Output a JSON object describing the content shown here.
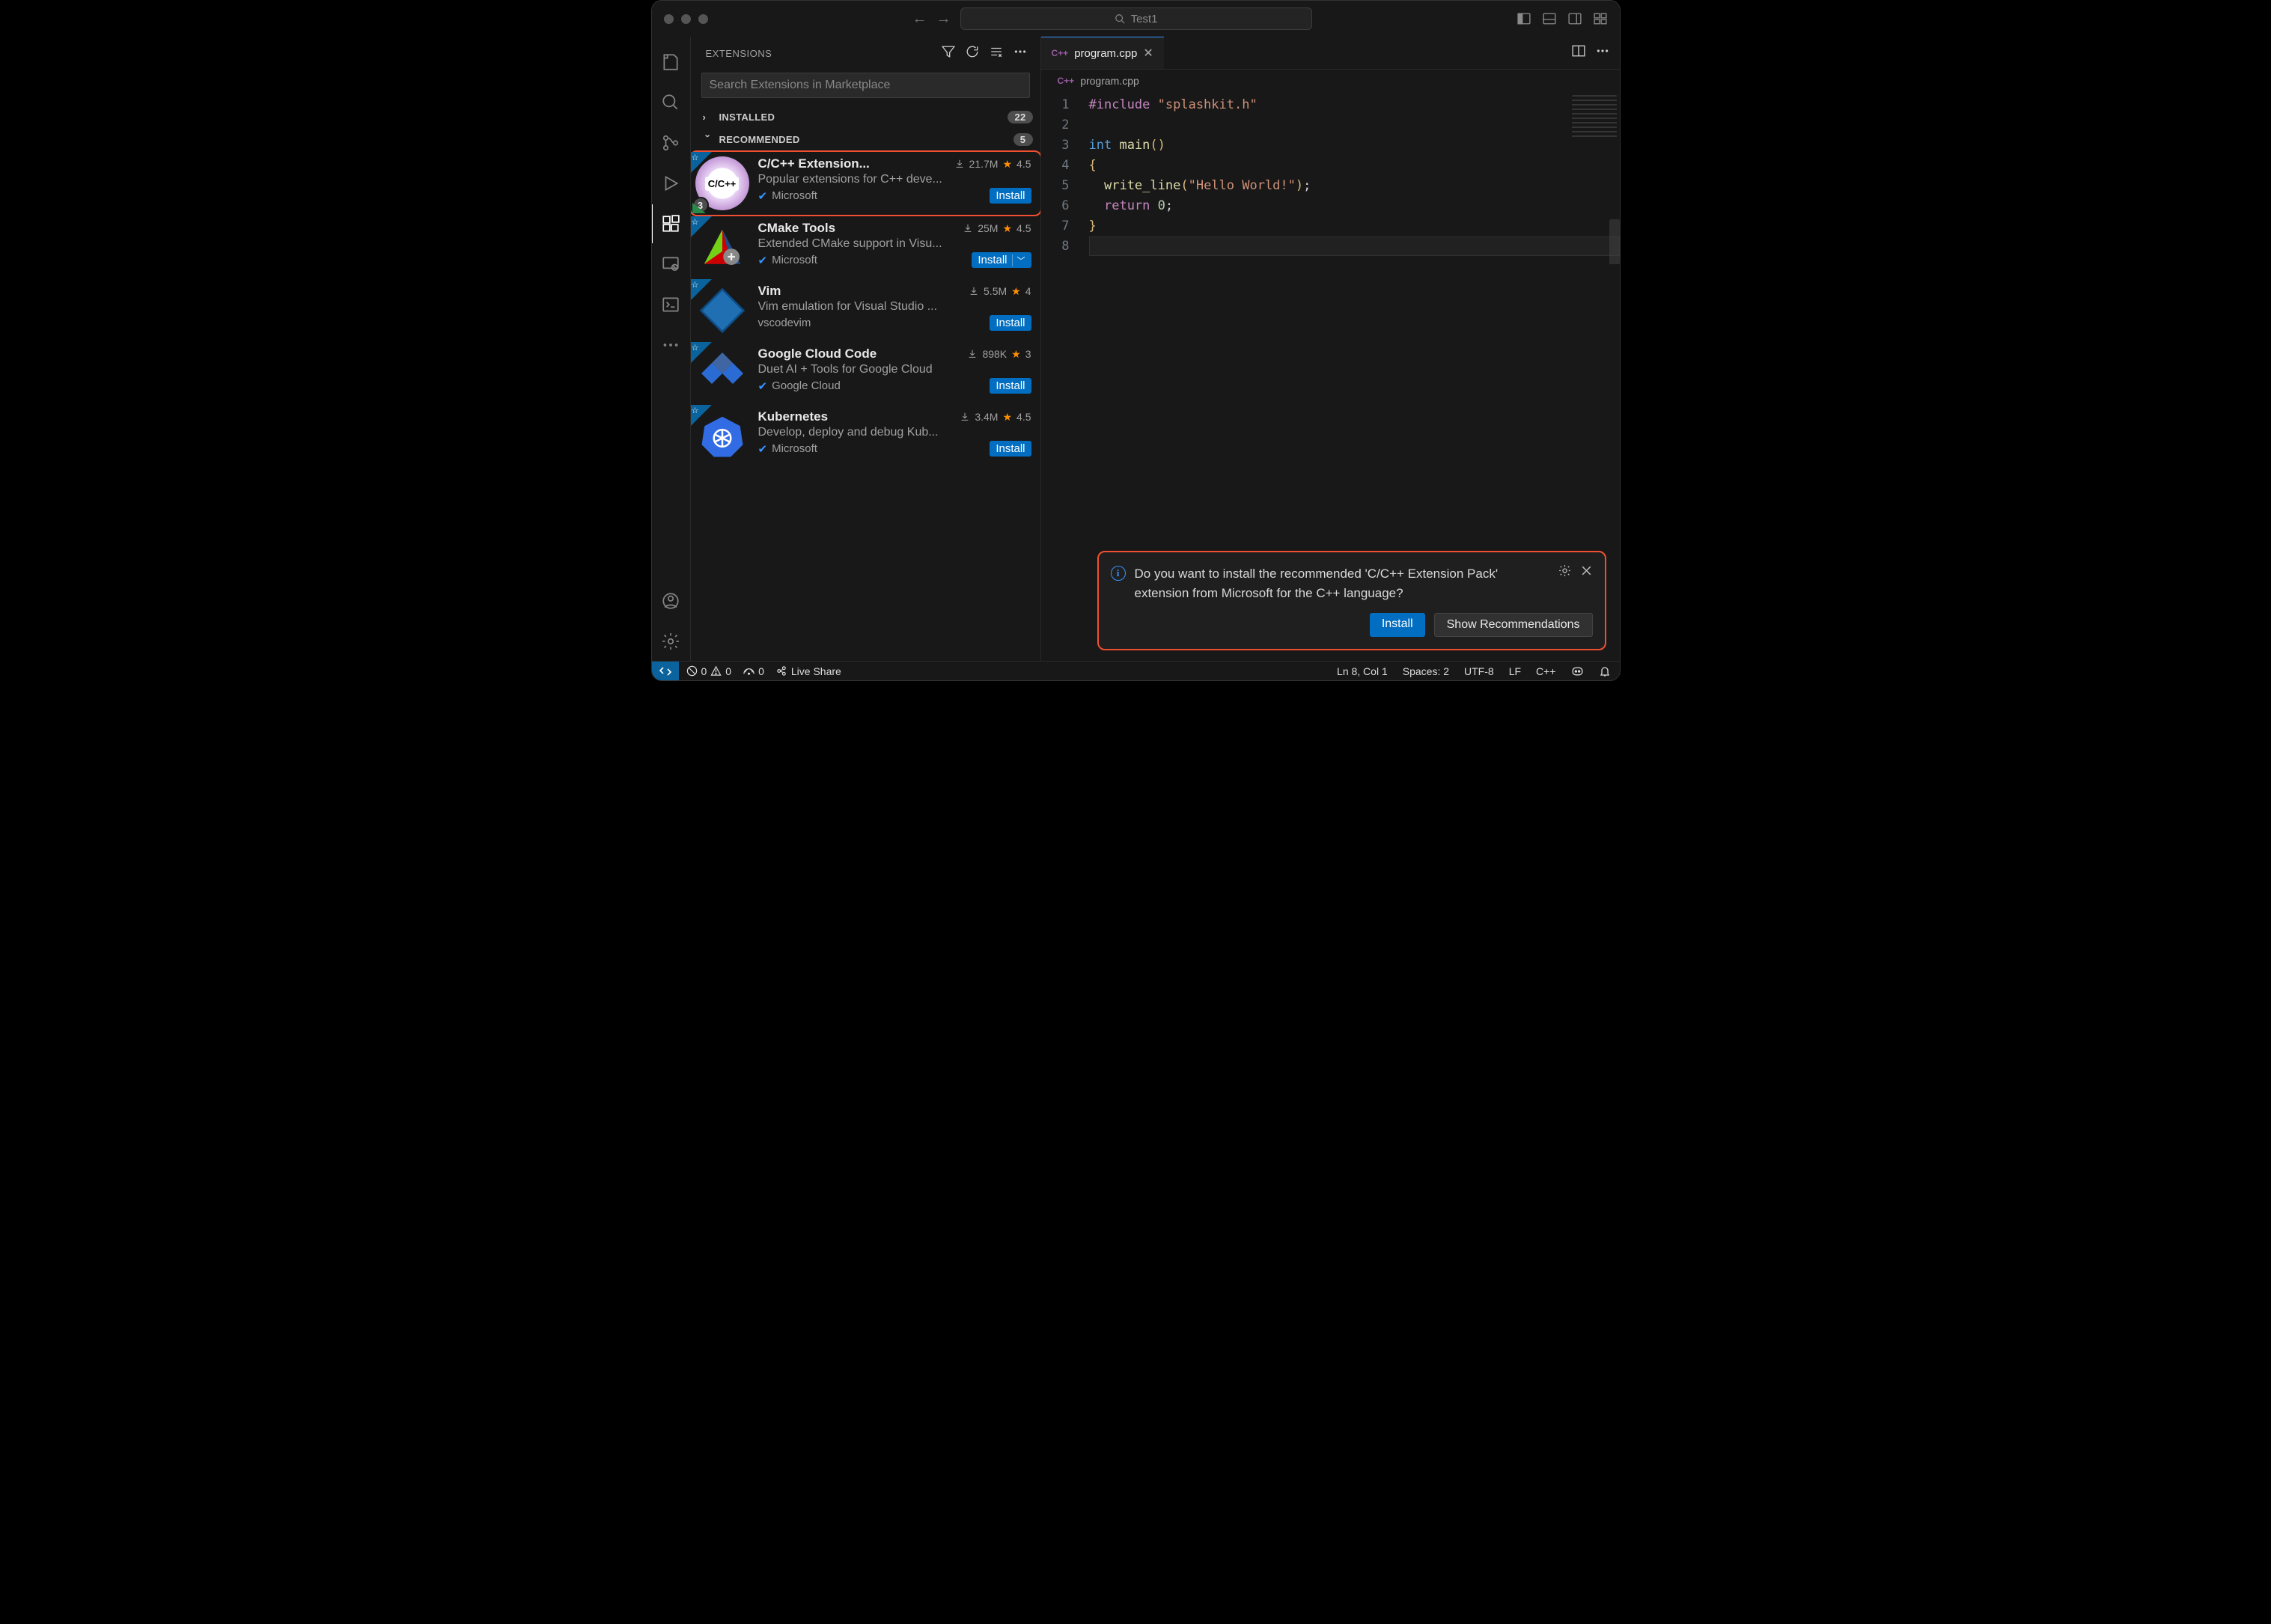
{
  "title": {
    "search": "Test1"
  },
  "sidebar": {
    "title": "EXTENSIONS",
    "search_placeholder": "Search Extensions in Marketplace",
    "installed": {
      "label": "INSTALLED",
      "count": "22"
    },
    "recommended": {
      "label": "RECOMMENDED",
      "count": "5"
    },
    "items": [
      {
        "name": "C/C++ Extension...",
        "downloads": "21.7M",
        "rating": "4.5",
        "desc": "Popular extensions for C++ deve...",
        "publisher": "Microsoft",
        "install": "Install",
        "badge": "3",
        "verified": true,
        "dropdown": false
      },
      {
        "name": "CMake Tools",
        "downloads": "25M",
        "rating": "4.5",
        "desc": "Extended CMake support in Visu...",
        "publisher": "Microsoft",
        "install": "Install",
        "verified": true,
        "dropdown": true
      },
      {
        "name": "Vim",
        "downloads": "5.5M",
        "rating": "4",
        "desc": "Vim emulation for Visual Studio ...",
        "publisher": "vscodevim",
        "install": "Install",
        "verified": false,
        "dropdown": false
      },
      {
        "name": "Google Cloud Code",
        "downloads": "898K",
        "rating": "3",
        "desc": "Duet AI + Tools for Google Cloud",
        "publisher": "Google Cloud",
        "install": "Install",
        "verified": true,
        "dropdown": false
      },
      {
        "name": "Kubernetes",
        "downloads": "3.4M",
        "rating": "4.5",
        "desc": "Develop, deploy and debug Kub...",
        "publisher": "Microsoft",
        "install": "Install",
        "verified": true,
        "dropdown": false
      }
    ]
  },
  "editor": {
    "tab": {
      "label": "program.cpp"
    },
    "crumb": "program.cpp",
    "lines": [
      "1",
      "2",
      "3",
      "4",
      "5",
      "6",
      "7",
      "8"
    ],
    "code": {
      "l1_include": "#include",
      "l1_hdr": "\"splashkit.h\"",
      "l3_int": "int",
      "l3_main": "main",
      "l5_fn": "write_line",
      "l5_arg": "\"Hello World!\"",
      "l6_return": "return",
      "l6_zero": "0"
    }
  },
  "toast": {
    "msg": "Do you want to install the recommended 'C/C++ Extension Pack' extension from Microsoft for the C++ language?",
    "install": "Install",
    "show": "Show Recommendations"
  },
  "status": {
    "errors": "0",
    "warnings": "0",
    "ports": "0",
    "live": "Live Share",
    "cursor": "Ln 8, Col 1",
    "spaces": "Spaces: 2",
    "enc": "UTF-8",
    "eol": "LF",
    "lang": "C++"
  }
}
